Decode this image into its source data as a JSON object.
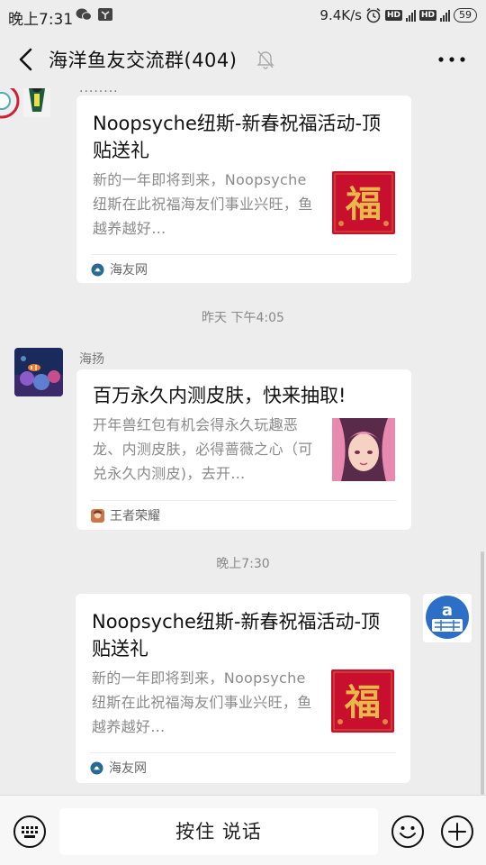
{
  "status_bar": {
    "time": "晚上7:31",
    "net_speed": "9.4K/s",
    "hd1": "HD",
    "hd2": "HD",
    "battery": "59",
    "icons": [
      "wechat-icon",
      "weibo-icon",
      "alarm-icon",
      "signal-icon",
      "battery-icon"
    ]
  },
  "header": {
    "title": "海洋鱼友交流群(404)",
    "icons": [
      "back-arrow-icon",
      "mute-bell-icon",
      "more-dots-icon"
    ]
  },
  "messages": [
    {
      "type": "link-card",
      "side": "left",
      "sender_partial": "........",
      "title": "Noopsyche纽斯-新春祝福活动-顶贴送礼",
      "description": "新的一年即将到来，Noopsyche纽斯在此祝福海友们事业兴旺，鱼越养越好…",
      "thumbnail": "fu-red-thumbnail",
      "source": "海友网"
    },
    {
      "type": "timestamp",
      "text": "昨天 下午4:05"
    },
    {
      "type": "link-card",
      "side": "left",
      "sender": "海扬",
      "title": "百万永久内测皮肤，快来抽取!",
      "description": "开年兽红包有机会得永久玩趣恶龙、内测皮肤，必得蔷薇之心（可兑永久内测皮)，去开…",
      "thumbnail": "game-character-thumbnail",
      "source": "王者荣耀"
    },
    {
      "type": "timestamp",
      "text": "晚上7:30"
    },
    {
      "type": "link-card",
      "side": "right",
      "title": "Noopsyche纽斯-新春祝福活动-顶贴送礼",
      "description": "新的一年即将到来，Noopsyche纽斯在此祝福海友们事业兴旺，鱼越养越好…",
      "thumbnail": "fu-red-thumbnail",
      "source": "海友网"
    }
  ],
  "input_bar": {
    "talk_label": "按住 说话",
    "icons": [
      "keyboard-icon",
      "emoji-icon",
      "plus-icon"
    ]
  },
  "colors": {
    "background": "#ededed",
    "card": "#ffffff",
    "fu_red": "#c8102e",
    "fu_gold": "#e8b84a"
  }
}
